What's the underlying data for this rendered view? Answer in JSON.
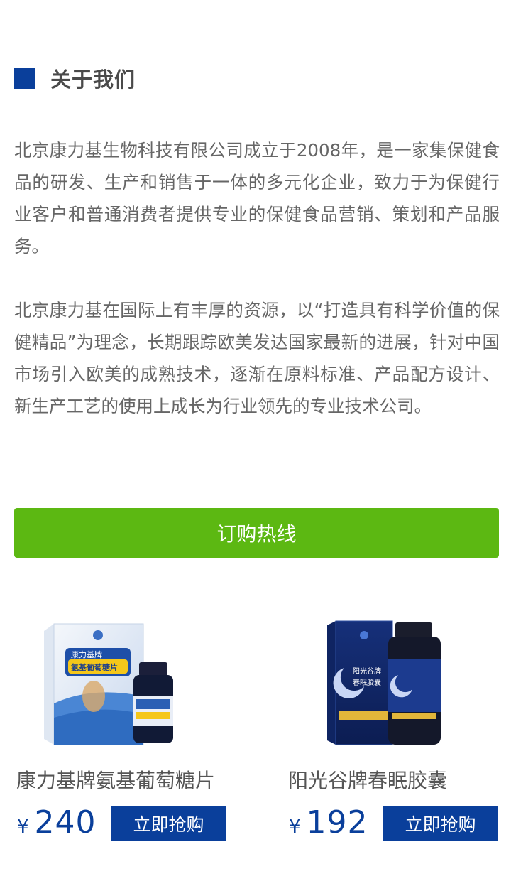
{
  "about": {
    "title": "关于我们",
    "paragraphs": [
      "北京康力基生物科技有限公司成立于2008年，是一家集保健食品的研发、生产和销售于一体的多元化企业，致力于为保健行业客户和普通消费者提供专业的保健食品营销、策划和产品服务。",
      "北京康力基在国际上有丰厚的资源，以“打造具有科学价值的保健精品”为理念，长期跟踪欧美发达国家最新的进展，针对中国市场引入欧美的成熟技术，逐渐在原料标准、产品配方设计、新生产工艺的使用上成长为行业领先的专业技术公司。"
    ]
  },
  "hotline": {
    "label": "订购热线"
  },
  "products": [
    {
      "name": "康力基牌氨基葡萄糖片",
      "currency": "¥",
      "price": "240",
      "buy_label": "立即抢购",
      "box_text_1": "康力基牌",
      "box_text_2": "氨基葡萄糖片"
    },
    {
      "name": "阳光谷牌春眠胶囊",
      "currency": "¥",
      "price": "192",
      "buy_label": "立即抢购",
      "box_text_1": "阳光谷牌",
      "box_text_2": "春眠胶囊"
    }
  ],
  "colors": {
    "brand_blue": "#0a3f9b",
    "hotline_green": "#5cb812"
  }
}
